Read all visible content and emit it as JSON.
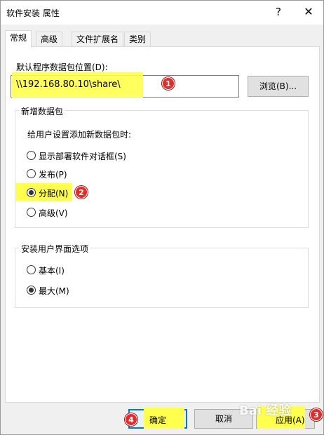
{
  "window": {
    "title": "软件安装 属性",
    "help_glyph": "?",
    "close_glyph": "✕"
  },
  "tabs": [
    {
      "label": "常规",
      "active": true
    },
    {
      "label": "高级",
      "active": false
    },
    {
      "label": "文件扩展名",
      "active": false
    },
    {
      "label": "类别",
      "active": false
    }
  ],
  "general": {
    "package_location_label": "默认程序数据包位置(D):",
    "package_location_value": "\\\\192.168.80.10\\share\\",
    "browse_label": "浏览(B)...",
    "new_packages": {
      "group_title": "新增数据包",
      "prompt": "给用户设置添加新数据包时:",
      "options": [
        {
          "label": "显示部署软件对话框(S)",
          "checked": false
        },
        {
          "label": "发布(P)",
          "checked": false
        },
        {
          "label": "分配(N)",
          "checked": true
        },
        {
          "label": "高级(V)",
          "checked": false
        }
      ]
    },
    "ui_options": {
      "group_title": "安装用户界面选项",
      "options": [
        {
          "label": "基本(I)",
          "checked": false
        },
        {
          "label": "最大(M)",
          "checked": true
        }
      ]
    }
  },
  "footer": {
    "ok_label": "确定",
    "cancel_label": "取消",
    "apply_label": "应用(A)"
  },
  "annotations": {
    "badge_1": "1",
    "badge_2": "2",
    "badge_3": "3",
    "badge_4": "4",
    "highlight_color": "#ffff4d",
    "badge_color": "#e22b2b"
  },
  "watermark": "Bai 经验"
}
